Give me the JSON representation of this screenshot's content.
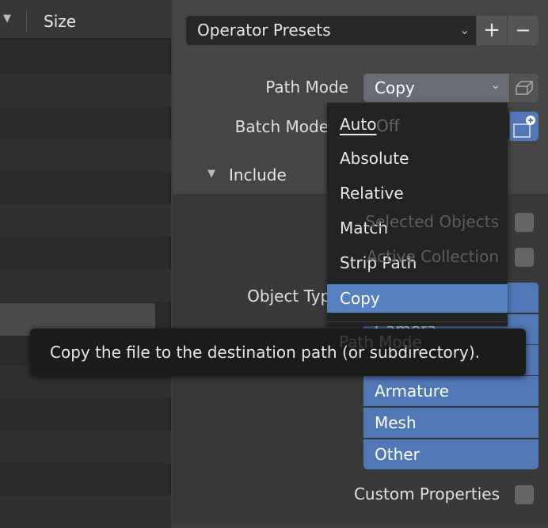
{
  "file_list": {
    "sort_icon": "triangle-down-icon",
    "size_header": "Size"
  },
  "presets": {
    "label": "Operator Presets",
    "add": "+",
    "remove": "−"
  },
  "path_mode": {
    "label": "Path Mode",
    "value": "Copy",
    "icon": "embed-cube-icon"
  },
  "batch_mode": {
    "label": "Batch Mode",
    "value": "Off",
    "icon": "new-folder-icon"
  },
  "include": {
    "label": "Include",
    "options": [
      "Selected Objects",
      "Active Collection"
    ]
  },
  "object_types": {
    "label": "Object Types",
    "items": [
      "",
      "Camera",
      "",
      "Armature",
      "Mesh",
      "Other"
    ]
  },
  "custom_properties": {
    "label": "Custom Properties"
  },
  "dropdown": {
    "title": "Path Mode",
    "items": [
      {
        "label": "Auto",
        "mnemonic": "A"
      },
      {
        "label": "Absolute",
        "mnemonic": "b"
      },
      {
        "label": "Relative",
        "mnemonic": "R"
      },
      {
        "label": "Match",
        "mnemonic": "M"
      },
      {
        "label": "Strip Path",
        "mnemonic": "S"
      },
      {
        "label": "Copy",
        "mnemonic": "C",
        "selected": true
      }
    ]
  },
  "tooltip": "Copy the file to the destination path (or subdirectory).",
  "colors": {
    "accent": "#5680c2",
    "object_type_button": "#5277b6",
    "menu_bg": "#232323"
  }
}
